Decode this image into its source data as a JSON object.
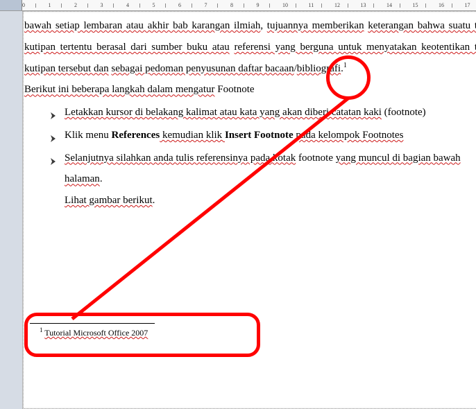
{
  "ruler": {
    "start": 0,
    "end": 17
  },
  "body": {
    "p1": {
      "t1": "bawah setiap lembaran atau akhir bab karangan ilmiah",
      "t2": ", ",
      "t3": "tujuannya memberikan",
      "t4": " ",
      "t5": "keterangan bahwa suatu teks kutipan tertentu berasal dari sumber buku atau",
      "t6": " ",
      "t7": "referensi yang berguna untuk menyatakan keotentikan teks kutipan tersebut dan",
      "t8": " ",
      "t9": "sebagai pedoman penyusunan daftar bacaan",
      "t10": "/",
      "t11": "bibliografi",
      "t12": ".",
      "sup": "1"
    },
    "p2": {
      "t1": "Berikut ini beberapa langkah dalam mengatur",
      "t2": " Footnote"
    },
    "items": [
      {
        "a": "Letakkan kursor di belakang kalimat atau kata yang akan diberi catatan kaki",
        "b": " (footnote)"
      },
      {
        "a": "Klik menu ",
        "bold1": "References",
        "b": " kemudian klik ",
        "bold2": "Insert Footnote",
        "c": " pada kelompok Footnotes"
      },
      {
        "a": "Selanjutnya silahkan anda tulis referensinya pada kotak",
        "b": " footnote ",
        "c": "yang muncul di bagian bawah halaman",
        "d": ".",
        "e": "Lihat gambar berikut",
        "f": "."
      }
    ]
  },
  "footnote": {
    "sup": "1",
    "text": "Tutorial Microsoft Office 2007"
  }
}
